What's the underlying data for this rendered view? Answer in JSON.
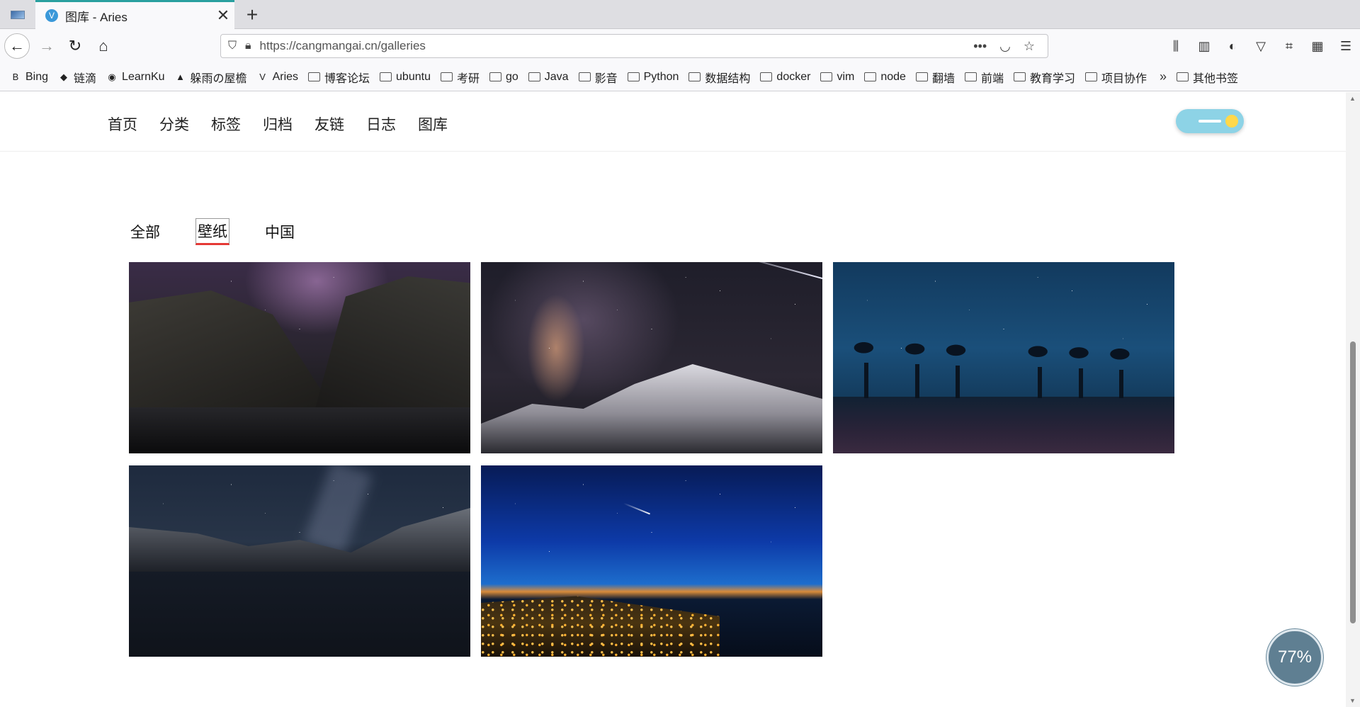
{
  "browser": {
    "tab_title": "图库 - Aries",
    "tab_favicon": "V",
    "url_scheme_host": "https://cangmangai.cn",
    "url_path": "/galleries",
    "bookmarks": [
      {
        "label": "Bing",
        "type": "site",
        "icon": "B"
      },
      {
        "label": "链滴",
        "type": "site",
        "icon": "◆"
      },
      {
        "label": "LearnKu",
        "type": "site",
        "icon": "◉"
      },
      {
        "label": "躲雨の屋檐",
        "type": "site",
        "icon": "▲"
      },
      {
        "label": "Aries",
        "type": "site",
        "icon": "V"
      },
      {
        "label": "博客论坛",
        "type": "folder"
      },
      {
        "label": "ubuntu",
        "type": "folder"
      },
      {
        "label": "考研",
        "type": "folder"
      },
      {
        "label": "go",
        "type": "folder"
      },
      {
        "label": "Java",
        "type": "folder"
      },
      {
        "label": "影音",
        "type": "folder"
      },
      {
        "label": "Python",
        "type": "folder"
      },
      {
        "label": "数据结构",
        "type": "folder"
      },
      {
        "label": "docker",
        "type": "folder"
      },
      {
        "label": "vim",
        "type": "folder"
      },
      {
        "label": "node",
        "type": "folder"
      },
      {
        "label": "翻墙",
        "type": "folder"
      },
      {
        "label": "前端",
        "type": "folder"
      },
      {
        "label": "教育学习",
        "type": "folder"
      },
      {
        "label": "项目协作",
        "type": "folder"
      }
    ],
    "overflow_label": "»",
    "other_bookmarks": "其他书签",
    "accent": "#2aa0a0"
  },
  "site": {
    "menu": [
      "首页",
      "分类",
      "标签",
      "归档",
      "友链",
      "日志",
      "图库"
    ],
    "theme_toggle": "light"
  },
  "gallery": {
    "filters": [
      "全部",
      "壁纸",
      "中国"
    ],
    "active_filter_index": 1,
    "photos": [
      {
        "subject": "canyon river under milky way"
      },
      {
        "subject": "snowy mountain with milky way and meteor"
      },
      {
        "subject": "baobab trees under starry blue sky"
      },
      {
        "subject": "mountain lake reflection at night"
      },
      {
        "subject": "city lights with star trails and meteor"
      }
    ]
  },
  "reading_progress": "77%"
}
